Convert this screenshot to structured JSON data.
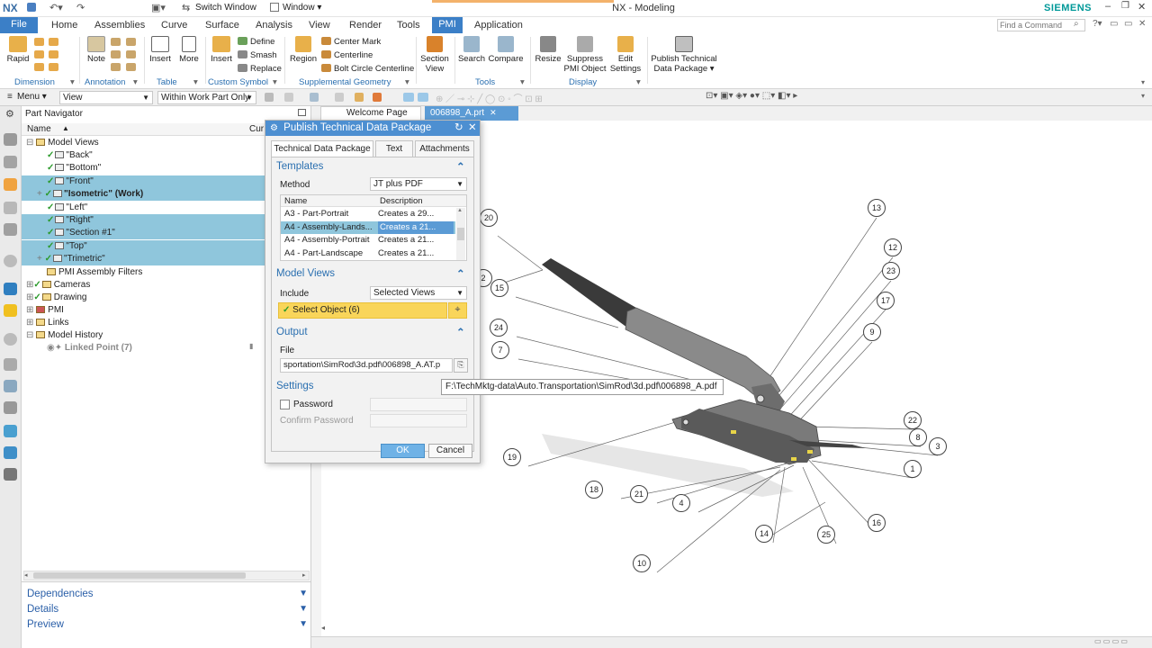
{
  "window": {
    "logo": "NX",
    "title": "NX - Modeling",
    "brand": "SIEMENS",
    "switch_window": "Switch Window",
    "window_menu": "Window ▾"
  },
  "menu": {
    "file": "File",
    "tabs": [
      "Home",
      "Assemblies",
      "Curve",
      "Surface",
      "Analysis",
      "View",
      "Render",
      "Tools",
      "PMI",
      "Application"
    ],
    "active_tab": "PMI",
    "find_placeholder": "Find a Command"
  },
  "ribbon": {
    "rapid": "Rapid",
    "note": "Note",
    "insert_table": "Insert",
    "more": "More",
    "insert_symbol": "Insert",
    "define": "Define",
    "smash": "Smash",
    "replace": "Replace",
    "region": "Region",
    "center_mark": "Center Mark",
    "centerline": "Centerline",
    "bolt_circle": "Bolt Circle Centerline",
    "section_view": [
      "Section",
      "View"
    ],
    "search": "Search",
    "compare": "Compare",
    "resize": "Resize",
    "suppress": [
      "Suppress",
      "PMI Object"
    ],
    "edit_settings": [
      "Edit",
      "Settings"
    ],
    "publish": [
      "Publish Technical",
      "Data Package ▾"
    ],
    "groups": {
      "dimension": "Dimension",
      "annotation": "Annotation",
      "table": "Table",
      "custom_symbol": "Custom Symbol",
      "supplemental": "Supplemental Geometry",
      "tools": "Tools",
      "display": "Display"
    }
  },
  "selbar": {
    "menu": "Menu ▾",
    "filter": "View",
    "scope": "Within Work Part Only"
  },
  "navigator": {
    "title": "Part Navigator",
    "col_name": "Name",
    "col_current": "Cur",
    "model_views": "Model Views",
    "views": [
      {
        "label": "\"Back\"",
        "selected": false,
        "bold": false
      },
      {
        "label": "\"Bottom\"",
        "selected": false,
        "bold": false
      },
      {
        "label": "\"Front\"",
        "selected": true,
        "bold": false
      },
      {
        "label": "\"Isometric\" (Work)",
        "selected": true,
        "bold": true
      },
      {
        "label": "\"Left\"",
        "selected": false,
        "bold": false
      },
      {
        "label": "\"Right\"",
        "selected": true,
        "bold": false
      },
      {
        "label": "\"Section #1\"",
        "selected": true,
        "bold": false
      },
      {
        "label": "\"Top\"",
        "selected": true,
        "bold": false
      },
      {
        "label": "\"Trimetric\"",
        "selected": true,
        "bold": false
      }
    ],
    "pmi_filters": "PMI Assembly Filters",
    "cameras": "Cameras",
    "drawing": "Drawing",
    "pmi": "PMI",
    "links": "Links",
    "model_history": "Model History",
    "linked_point": "Linked Point (7)",
    "dependencies": "Dependencies",
    "details": "Details",
    "preview": "Preview"
  },
  "gfxtabs": {
    "welcome": "Welcome Page",
    "part": "006898_A.prt"
  },
  "dialog": {
    "title": "Publish Technical Data Package",
    "tabs": [
      "Technical Data Package",
      "Text",
      "Attachments"
    ],
    "templates": "Templates",
    "method_label": "Method",
    "method_value": "JT plus PDF",
    "col_name": "Name",
    "col_desc": "Description",
    "rows": [
      {
        "name": "A3 - Part-Portrait",
        "desc": "Creates a 29..."
      },
      {
        "name": "A4 - Assembly-Lands...",
        "desc": "Creates a 21..."
      },
      {
        "name": "A4 - Assembly-Portrait",
        "desc": "Creates a 21..."
      },
      {
        "name": "A4 - Part-Landscape",
        "desc": "Creates a 21..."
      }
    ],
    "selected_row": 1,
    "model_views": "Model Views",
    "include_label": "Include",
    "include_value": "Selected Views",
    "select_object": "Select Object (6)",
    "output": "Output",
    "file_label": "File",
    "file_value": "sportation\\SimRod\\3d.pdf\\006898_A.AT.p",
    "settings": "Settings",
    "password": "Password",
    "confirm_password": "Confirm Password",
    "ok": "OK",
    "cancel": "Cancel"
  },
  "tooltip": "F:\\TechMktg-data\\Auto.Transportation\\SimRod\\3d.pdf\\006898_A.pdf",
  "callouts": [
    "20",
    "13",
    "2",
    "15",
    "12",
    "23",
    "17",
    "24",
    "9",
    "7",
    "22",
    "8",
    "3",
    "19",
    "1",
    "18",
    "21",
    "4",
    "16",
    "14",
    "25",
    "10"
  ]
}
